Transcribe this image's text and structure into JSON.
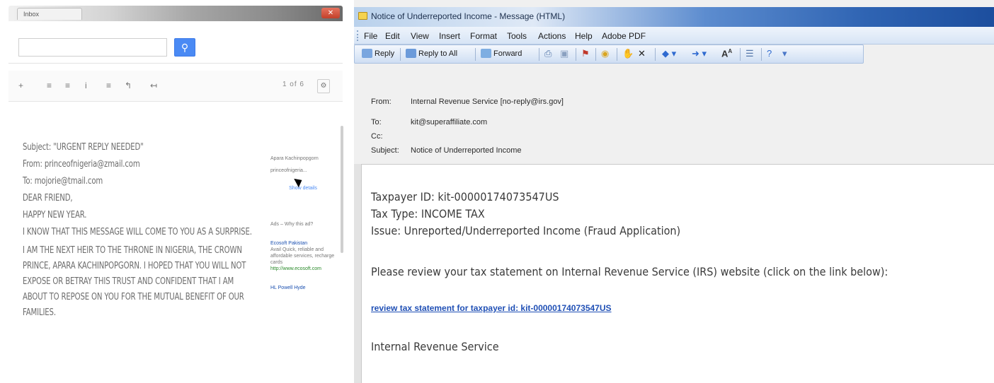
{
  "left": {
    "tab_title": "Inbox",
    "search": {
      "value": "",
      "button_icon": "search-icon"
    },
    "toolbar": {
      "buttons": [
        "+",
        "≡",
        "≡",
        "i",
        "≡",
        "↰",
        "↤"
      ],
      "pager": "1 of 6",
      "page_controls": "‹ ›"
    },
    "message": {
      "subject": "Subject: \"URGENT REPLY NEEDED\"",
      "from": "From: princeofnigeria@zmail.com",
      "to": "To: mojorie@tmail.com",
      "greeting": "DEAR FRIEND,",
      "line1": "HAPPY NEW YEAR.",
      "para1": "I KNOW THAT THIS MESSAGE WILL COME TO YOU AS A SURPRISE.",
      "para2": "I AM THE NEXT HEIR TO THE THRONE IN NIGERIA, THE CROWN PRINCE, APARA KACHINPOPGORN. I HOPED THAT YOU WILL NOT EXPOSE OR BETRAY THIS TRUST AND CONFIDENT THAT I AM ABOUT TO REPOSE ON YOU FOR THE MUTUAL BENEFIT OF OUR FAMILIES."
    },
    "sidebar": {
      "contact": "Apara Kachinpopgorn",
      "email": "princeofnigeria...",
      "more": "Show details",
      "related": "Ads – Why this ad?",
      "ad1": "Ecosoft Pakistan",
      "ad2": "Avail Quick, reliable and affordable services, recharge cards",
      "ad3": "http://www.ecosoft.com",
      "ad4": "HL Powell Hyde"
    },
    "colors": {
      "accent": "#4a8af4",
      "text": "#6d6d6d"
    }
  },
  "right": {
    "window_title": "Notice of Underreported Income - Message (HTML)",
    "menu": [
      "File",
      "Edit",
      "View",
      "Insert",
      "Format",
      "Tools",
      "Actions",
      "Help",
      "Adobe PDF"
    ],
    "toolbar": {
      "reply": "Reply",
      "reply_all": "Reply to All",
      "forward": "Forward"
    },
    "headers": {
      "from_label": "From:",
      "from": "Internal Revenue Service [no-reply@irs.gov]",
      "to_label": "To:",
      "to": "kit@superaffiliate.com",
      "cc_label": "Cc:",
      "cc": "",
      "subject_label": "Subject:",
      "subject": "Notice of Underreported Income"
    },
    "body": {
      "taxpayer_id": "Taxpayer ID: kit-00000174073547US",
      "tax_type": "Tax Type: INCOME TAX",
      "issue": "Issue: Unreported/Underreported Income (Fraud Application)",
      "instruction": "Please review your tax statement on Internal Revenue Service (IRS) website (click on the link below):",
      "link": "review tax statement for taxpayer id: kit-00000174073547US",
      "signature": "Internal Revenue Service"
    },
    "colors": {
      "title_gradient_end": "#1c4e9e",
      "link": "#1f4fb5"
    }
  }
}
